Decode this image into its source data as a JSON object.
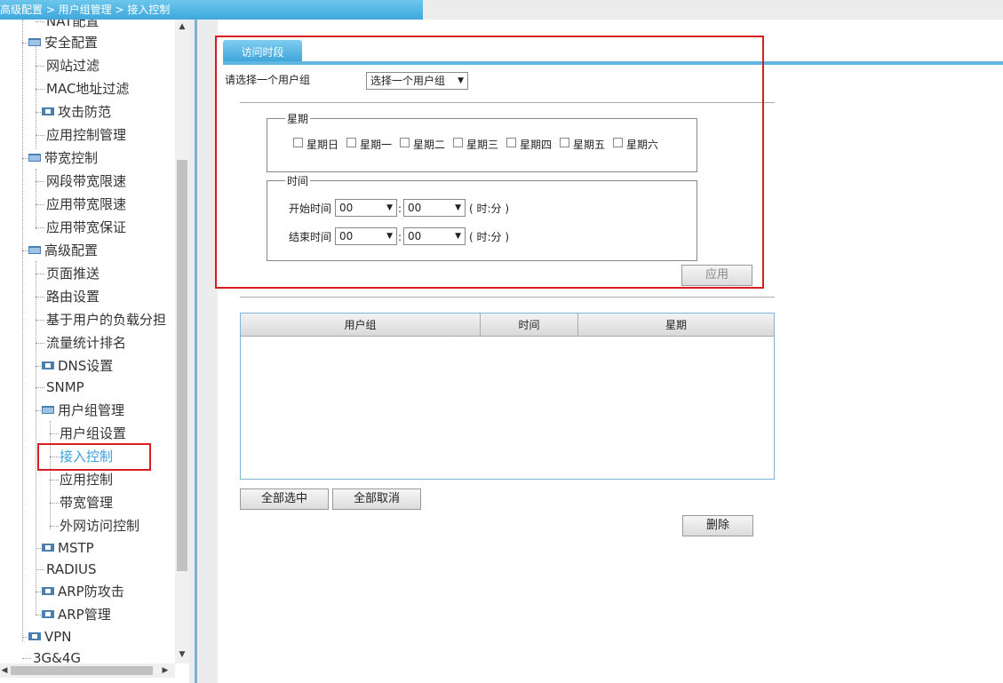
{
  "breadcrumb": "高级配置 > 用户组管理 > 接入控制",
  "sidebar": {
    "items": [
      {
        "label": "NAT配置"
      },
      {
        "label": "安全配置"
      },
      {
        "label": "网站过滤"
      },
      {
        "label": "MAC地址过滤"
      },
      {
        "label": "攻击防范"
      },
      {
        "label": "应用控制管理"
      },
      {
        "label": "带宽控制"
      },
      {
        "label": "网段带宽限速"
      },
      {
        "label": "应用带宽限速"
      },
      {
        "label": "应用带宽保证"
      },
      {
        "label": "高级配置"
      },
      {
        "label": "页面推送"
      },
      {
        "label": "路由设置"
      },
      {
        "label": "基于用户的负载分担"
      },
      {
        "label": "流量统计排名"
      },
      {
        "label": "DNS设置"
      },
      {
        "label": "SNMP"
      },
      {
        "label": "用户组管理"
      },
      {
        "label": "用户组设置"
      },
      {
        "label": "接入控制"
      },
      {
        "label": "应用控制"
      },
      {
        "label": "带宽管理"
      },
      {
        "label": "外网访问控制"
      },
      {
        "label": "MSTP"
      },
      {
        "label": "RADIUS"
      },
      {
        "label": "ARP防攻击"
      },
      {
        "label": "ARP管理"
      },
      {
        "label": "VPN"
      },
      {
        "label": "3G&4G"
      }
    ]
  },
  "main": {
    "tab_label": "访问时段",
    "user_group_label": "请选择一个用户组",
    "user_group_select": "选择一个用户组",
    "weekday_legend": "星期",
    "weekdays": [
      "星期日",
      "星期一",
      "星期二",
      "星期三",
      "星期四",
      "星期五",
      "星期六"
    ],
    "time_legend": "时间",
    "start_time_label": "开始时间",
    "end_time_label": "结束时间",
    "start_hour": "00",
    "start_minute": "00",
    "end_hour": "00",
    "end_minute": "00",
    "time_colon": ":",
    "time_unit": "( 时:分 )",
    "apply_button": "应用",
    "table_headers": [
      "用户组",
      "时间",
      "星期"
    ],
    "select_all_button": "全部选中",
    "deselect_all_button": "全部取消",
    "delete_button": "删除"
  },
  "colors": {
    "accent": "#3aa2d8",
    "highlight_box": "#d81e1e",
    "active_item": "#3aa0d8"
  }
}
